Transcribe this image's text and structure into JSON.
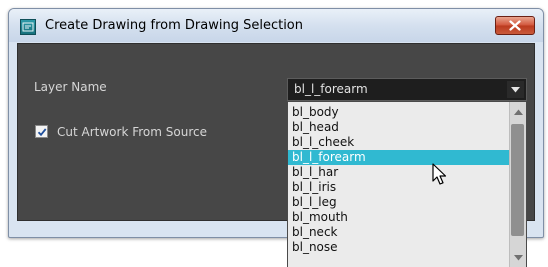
{
  "window": {
    "title": "Create Drawing from Drawing Selection"
  },
  "form": {
    "layer_name_label": "Layer Name",
    "layer_name_value": "bl_l_forearm",
    "cut_artwork_label": "Cut Artwork From Source",
    "cut_artwork_checked": true
  },
  "dropdown": {
    "items": [
      "bl_body",
      "bl_head",
      "bl_l_cheek",
      "bl_l_forearm",
      "bl_l_har",
      "bl_l_iris",
      "bl_l_leg",
      "bl_mouth",
      "bl_neck",
      "bl_nose"
    ],
    "selected_index": 3
  },
  "colors": {
    "selection": "#30b9d1",
    "panel_background": "#474747",
    "close_button": "#c94a2e"
  },
  "icons": {
    "app": "toon-boom-app-icon",
    "close": "close-icon",
    "combo_arrow": "chevron-down-icon",
    "check": "checkmark-icon",
    "scroll_up": "scroll-up-arrow-icon",
    "scroll_down": "scroll-down-arrow-icon",
    "cursor": "mouse-pointer-icon"
  }
}
